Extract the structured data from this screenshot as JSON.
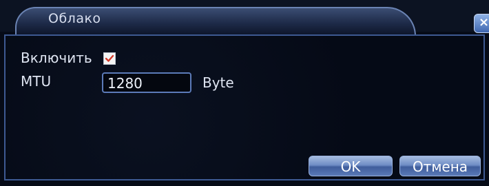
{
  "dialog": {
    "title": "Облако",
    "close_glyph": "×"
  },
  "form": {
    "enable_label": "Включить",
    "enable_checked": true,
    "mtu_label": "MTU",
    "mtu_value": "1280",
    "mtu_unit": "Byte"
  },
  "buttons": {
    "ok_label": "OK",
    "cancel_label": "Отмена"
  },
  "colors": {
    "accent": "#5c7bb9",
    "checkmark": "#d43a2a"
  }
}
